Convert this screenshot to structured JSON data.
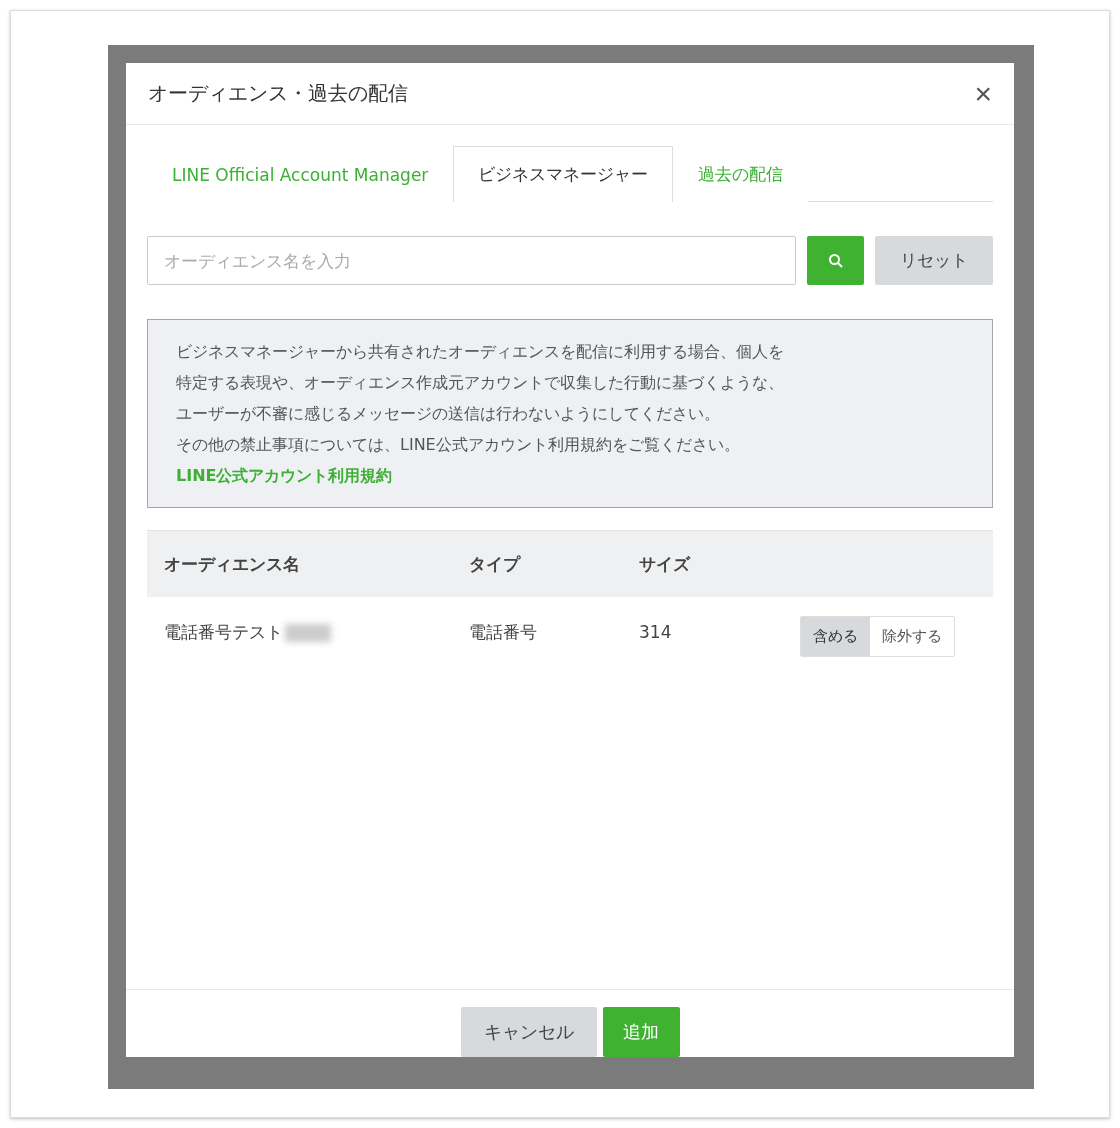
{
  "dialog": {
    "title": "オーディエンス・過去の配信",
    "close": "×"
  },
  "tabs": [
    {
      "label": "LINE Official Account Manager",
      "selected": false
    },
    {
      "label": "ビジネスマネージャー",
      "selected": true
    },
    {
      "label": "過去の配信",
      "selected": false
    }
  ],
  "search": {
    "placeholder": "オーディエンス名を入力",
    "reset": "リセット"
  },
  "notice": {
    "lines": [
      "ビジネスマネージャーから共有されたオーディエンスを配信に利用する場合、個人を",
      "特定する表現や、オーディエンス作成元アカウントで収集した行動に基づくような、",
      "ユーザーが不審に感じるメッセージの送信は行わないようにしてください。",
      "その他の禁止事項については、LINE公式アカウント利用規約をご覧ください。"
    ],
    "link": "LINE公式アカウント利用規約"
  },
  "table": {
    "columns": [
      "オーディエンス名",
      "タイプ",
      "サイズ"
    ],
    "rows": [
      {
        "name": "電話番号テスト",
        "blurred": true,
        "type": "電話番号",
        "size": "314",
        "options": [
          {
            "label": "含める",
            "selected": true
          },
          {
            "label": "除外する",
            "selected": false
          }
        ]
      }
    ]
  },
  "footer": {
    "cancel": "キャンセル",
    "add": "追加"
  }
}
